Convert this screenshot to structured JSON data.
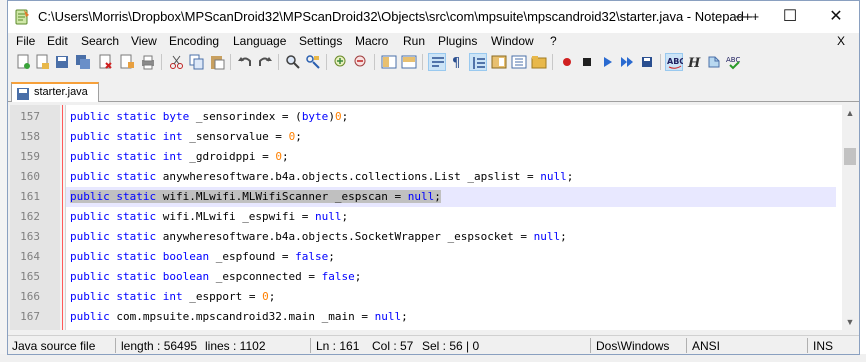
{
  "window": {
    "title": "C:\\Users\\Morris\\Dropbox\\MPScanDroid32\\MPScanDroid32\\Objects\\src\\com\\mpsuite\\mpscandroid32\\starter.java - Notepad++",
    "min_glyph": "—",
    "max_glyph": "☐",
    "close_glyph": "✕"
  },
  "menu": {
    "items": [
      "File",
      "Edit",
      "Search",
      "View",
      "Encoding",
      "Language",
      "Settings",
      "Macro",
      "Run",
      "Plugins",
      "Window",
      "?"
    ],
    "close_doc": "X"
  },
  "toolbar": {
    "buttons": [
      "new-file-icon",
      "open-file-icon",
      "save-icon",
      "save-all-icon",
      "close-icon",
      "close-all-icon",
      "print-icon",
      "cut-icon",
      "copy-icon",
      "paste-icon",
      "undo-icon",
      "redo-icon",
      "find-icon",
      "replace-icon",
      "zoom-in-icon",
      "zoom-out-icon",
      "sync-vertical-icon",
      "sync-horizontal-icon",
      "word-wrap-icon",
      "show-all-chars-icon",
      "indent-guide-icon",
      "document-map-icon",
      "function-list-icon",
      "folder-workspace-icon",
      "record-macro-icon",
      "stop-record-icon",
      "play-macro-icon",
      "play-multiple-icon",
      "save-macro-icon",
      "spell-check-icon",
      "highlight-icon",
      "translate-icon",
      "autocorrect-icon"
    ]
  },
  "tabs": [
    {
      "label": "starter.java"
    }
  ],
  "editor": {
    "lines": [
      {
        "n": "157",
        "tokens": [
          {
            "t": "public static ",
            "c": "kw"
          },
          {
            "t": "byte",
            "c": "kw"
          },
          {
            "t": " _sensorindex = (",
            "c": ""
          },
          {
            "t": "byte",
            "c": "kw"
          },
          {
            "t": ")",
            "c": ""
          },
          {
            "t": "0",
            "c": "num"
          },
          {
            "t": ";",
            "c": ""
          }
        ]
      },
      {
        "n": "158",
        "tokens": [
          {
            "t": "public static ",
            "c": "kw"
          },
          {
            "t": "int",
            "c": "kw"
          },
          {
            "t": " _sensorvalue = ",
            "c": ""
          },
          {
            "t": "0",
            "c": "num"
          },
          {
            "t": ";",
            "c": ""
          }
        ]
      },
      {
        "n": "159",
        "tokens": [
          {
            "t": "public static ",
            "c": "kw"
          },
          {
            "t": "int",
            "c": "kw"
          },
          {
            "t": " _gdroidppi = ",
            "c": ""
          },
          {
            "t": "0",
            "c": "num"
          },
          {
            "t": ";",
            "c": ""
          }
        ]
      },
      {
        "n": "160",
        "tokens": [
          {
            "t": "public static ",
            "c": "kw"
          },
          {
            "t": "anywheresoftware.b4a.objects.collections.List _apslist = ",
            "c": ""
          },
          {
            "t": "null",
            "c": "kw"
          },
          {
            "t": ";",
            "c": ""
          }
        ]
      },
      {
        "n": "161",
        "tokens": [
          {
            "t": "public static ",
            "c": "kw"
          },
          {
            "t": "wifi.MLwifi.MLWifiScanner _espscan = ",
            "c": ""
          },
          {
            "t": "null",
            "c": "kw"
          },
          {
            "t": ";",
            "c": ""
          }
        ]
      },
      {
        "n": "162",
        "tokens": [
          {
            "t": "public static ",
            "c": "kw"
          },
          {
            "t": "wifi.MLwifi _espwifi = ",
            "c": ""
          },
          {
            "t": "null",
            "c": "kw"
          },
          {
            "t": ";",
            "c": ""
          }
        ]
      },
      {
        "n": "163",
        "tokens": [
          {
            "t": "public static ",
            "c": "kw"
          },
          {
            "t": "anywheresoftware.b4a.objects.SocketWrapper _espsocket = ",
            "c": ""
          },
          {
            "t": "null",
            "c": "kw"
          },
          {
            "t": ";",
            "c": ""
          }
        ]
      },
      {
        "n": "164",
        "tokens": [
          {
            "t": "public static ",
            "c": "kw"
          },
          {
            "t": "boolean",
            "c": "kw"
          },
          {
            "t": " _espfound = ",
            "c": ""
          },
          {
            "t": "false",
            "c": "kw"
          },
          {
            "t": ";",
            "c": ""
          }
        ]
      },
      {
        "n": "165",
        "tokens": [
          {
            "t": "public static ",
            "c": "kw"
          },
          {
            "t": "boolean",
            "c": "kw"
          },
          {
            "t": " _espconnected = ",
            "c": ""
          },
          {
            "t": "false",
            "c": "kw"
          },
          {
            "t": ";",
            "c": ""
          }
        ]
      },
      {
        "n": "166",
        "tokens": [
          {
            "t": "public static ",
            "c": "kw"
          },
          {
            "t": "int",
            "c": "kw"
          },
          {
            "t": " _espport = ",
            "c": ""
          },
          {
            "t": "0",
            "c": "num"
          },
          {
            "t": ";",
            "c": ""
          }
        ]
      },
      {
        "n": "167",
        "tokens": [
          {
            "t": "public ",
            "c": "kw"
          },
          {
            "t": "com.mpsuite.mpscandroid32.main _main = ",
            "c": ""
          },
          {
            "t": "null",
            "c": "kw"
          },
          {
            "t": ";",
            "c": ""
          }
        ]
      }
    ],
    "current_line": "161"
  },
  "status": {
    "language": "Java source file",
    "length": "length : 56495",
    "lines": "lines : 1102",
    "ln": "Ln : 161",
    "col": "Col : 57",
    "sel": "Sel : 56 | 0",
    "eol": "Dos\\Windows",
    "encoding": "ANSI",
    "mode": "INS"
  },
  "colors": {
    "keyword": "#0000ff",
    "number": "#ff8000",
    "current_line": "#e8e8ff",
    "tab_accent": "#f6a03a"
  }
}
